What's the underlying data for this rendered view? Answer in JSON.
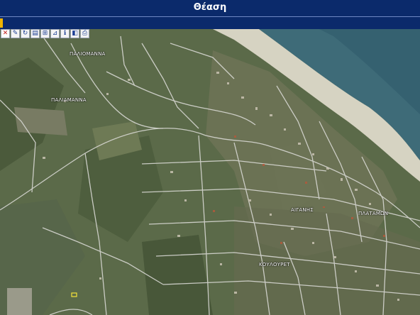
{
  "header": {
    "title": "Θέαση"
  },
  "colors": {
    "header_bg": "#0b2a6b",
    "accent": "#f0b400",
    "sea": "#3f6f7e",
    "beach": "#d9d6c6",
    "land": "#5d6b4c",
    "roads": "#d8d8d8"
  },
  "toolbar": {
    "tools": [
      {
        "icon": "close-icon",
        "glyph": "✕"
      },
      {
        "icon": "edit-pencil-icon",
        "glyph": "✎"
      },
      {
        "icon": "refresh-icon",
        "glyph": "↻"
      },
      {
        "icon": "document-icon",
        "glyph": "▤"
      },
      {
        "icon": "ruler-icon",
        "glyph": "⊞"
      },
      {
        "icon": "measure-area-icon",
        "glyph": "⊿"
      },
      {
        "icon": "info-icon",
        "glyph": "ℹ"
      },
      {
        "icon": "layers-icon",
        "glyph": "◧"
      },
      {
        "icon": "print-icon",
        "glyph": "⎙"
      }
    ]
  },
  "map": {
    "place_labels": [
      {
        "id": "paliomanna",
        "text": "ΠΑΛΙΟΜΑΝΝΑ"
      },
      {
        "id": "paliamanna",
        "text": "ΠΑΛΙΑΜΑΝΝΑ"
      },
      {
        "id": "aiganis",
        "text": "ΑΙΓΑΝΗΣ"
      },
      {
        "id": "platamon",
        "text": "ΠΛΑΤΑΜΩΝ"
      },
      {
        "id": "koulouretes",
        "text": "ΚΟΥΛΟΥΡΕΤ"
      }
    ]
  }
}
